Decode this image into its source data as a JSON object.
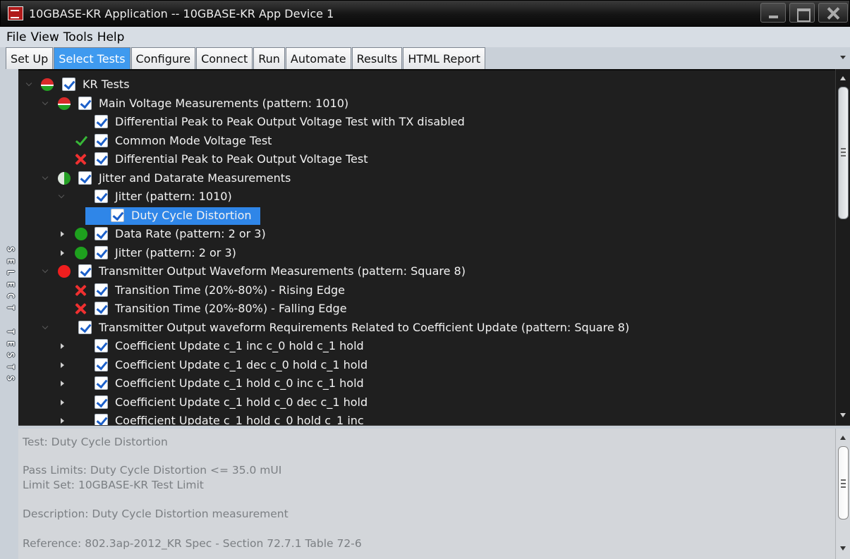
{
  "window": {
    "title": "10GBASE-KR Application -- 10GBASE-KR App Device 1"
  },
  "menu": [
    "File",
    "View",
    "Tools",
    "Help"
  ],
  "tabs": [
    {
      "label": "Set Up",
      "active": false
    },
    {
      "label": "Select Tests",
      "active": true
    },
    {
      "label": "Configure",
      "active": false
    },
    {
      "label": "Connect",
      "active": false
    },
    {
      "label": "Run",
      "active": false
    },
    {
      "label": "Automate",
      "active": false
    },
    {
      "label": "Results",
      "active": false
    },
    {
      "label": "HTML Report",
      "active": false
    }
  ],
  "side_label": "SELECT TESTS",
  "colors": {
    "tree_background": "#1f1f1f",
    "selection": "#2f86e8",
    "pass": "#38b838",
    "fail": "#f03030"
  },
  "tree": [
    {
      "text": "KR Tests",
      "status": "mixed",
      "checked": true
    },
    {
      "text": "Main Voltage Measurements (pattern: 1010)",
      "status": "mixed",
      "checked": true
    },
    {
      "text": "Differential Peak to Peak Output Voltage Test with TX disabled",
      "status": "none",
      "checked": true
    },
    {
      "text": "Common Mode Voltage Test",
      "status": "pass",
      "checked": true
    },
    {
      "text": "Differential Peak to Peak Output Voltage Test",
      "status": "fail",
      "checked": true
    },
    {
      "text": "Jitter and Datarate Measurements",
      "status": "partial",
      "checked": true
    },
    {
      "text": "Jitter (pattern: 1010)",
      "status": "none",
      "checked": true
    },
    {
      "text": "Duty Cycle Distortion",
      "status": "none",
      "checked": true,
      "selected": true
    },
    {
      "text": "Data Rate (pattern: 2 or 3)",
      "status": "pass-group",
      "checked": true
    },
    {
      "text": "Jitter (pattern: 2 or 3)",
      "status": "pass-group",
      "checked": true
    },
    {
      "text": "Transmitter Output Waveform Measurements (pattern: Square 8)",
      "status": "fail-group",
      "checked": true
    },
    {
      "text": "Transition Time (20%-80%) - Rising Edge",
      "status": "fail",
      "checked": true
    },
    {
      "text": "Transition Time (20%-80%) - Falling Edge",
      "status": "fail",
      "checked": true
    },
    {
      "text": "Transmitter Output waveform Requirements Related to Coefficient Update (pattern: Square 8)",
      "status": "none",
      "checked": true
    },
    {
      "text": "Coefficient Update c_1 inc c_0 hold c_1 hold",
      "status": "none",
      "checked": true
    },
    {
      "text": "Coefficient Update c_1 dec c_0 hold c_1 hold",
      "status": "none",
      "checked": true
    },
    {
      "text": "Coefficient Update c_1 hold c_0 inc c_1 hold",
      "status": "none",
      "checked": true
    },
    {
      "text": "Coefficient Update c_1 hold c_0 dec c_1 hold",
      "status": "none",
      "checked": true
    },
    {
      "text": "Coefficient Update c_1 hold c_0 hold c_1 inc",
      "status": "none",
      "checked": true
    }
  ],
  "info": {
    "test": "Test: Duty Cycle Distortion",
    "pass_limits": "Pass Limits: Duty Cycle Distortion <= 35.0 mUI",
    "limit_set": "Limit Set: 10GBASE-KR Test Limit",
    "description": "Description: Duty Cycle Distortion measurement",
    "reference": "Reference: 802.3ap-2012_KR Spec - Section 72.7.1 Table 72-6"
  }
}
